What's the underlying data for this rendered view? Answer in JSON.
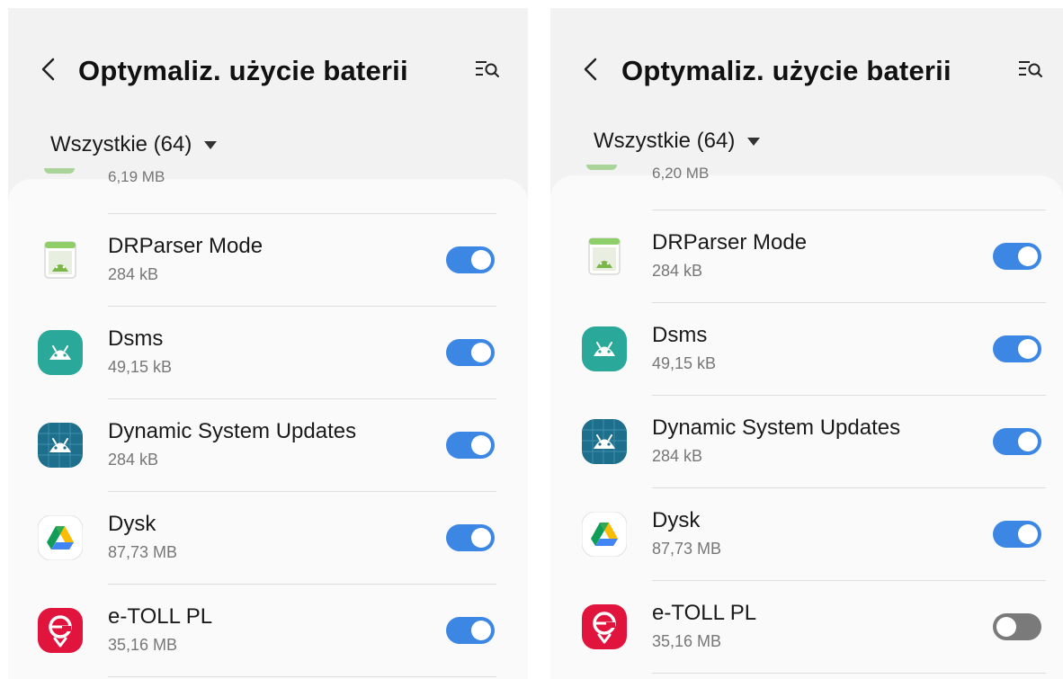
{
  "screens": [
    {
      "header": {
        "title": "Optymaliz. użycie baterii"
      },
      "filter": {
        "label": "Wszystkie (64)"
      },
      "partial_item": {
        "size": "6,19 MB"
      },
      "apps": [
        {
          "name": "DRParser Mode",
          "size": "284 kB",
          "enabled": true
        },
        {
          "name": "Dsms",
          "size": "49,15 kB",
          "enabled": true
        },
        {
          "name": "Dynamic System Updates",
          "size": "284 kB",
          "enabled": true
        },
        {
          "name": "Dysk",
          "size": "87,73 MB",
          "enabled": true
        },
        {
          "name": "e-TOLL PL",
          "size": "35,16 MB",
          "enabled": true
        }
      ]
    },
    {
      "header": {
        "title": "Optymaliz. użycie baterii"
      },
      "filter": {
        "label": "Wszystkie (64)"
      },
      "partial_item": {
        "size": "6,20 MB"
      },
      "apps": [
        {
          "name": "DRParser Mode",
          "size": "284 kB",
          "enabled": true
        },
        {
          "name": "Dsms",
          "size": "49,15 kB",
          "enabled": true
        },
        {
          "name": "Dynamic System Updates",
          "size": "284 kB",
          "enabled": true
        },
        {
          "name": "Dysk",
          "size": "87,73 MB",
          "enabled": true
        },
        {
          "name": "e-TOLL PL",
          "size": "35,16 MB",
          "enabled": false
        }
      ]
    }
  ],
  "colors": {
    "toggle_on": "#3c87e4",
    "toggle_off": "#7a7a7a",
    "dsms_icon": "#2aa89a",
    "dynamic_updates_icon": "#1e6f8c",
    "etoll_icon": "#e0143c"
  },
  "icons": [
    "back-arrow-icon",
    "search-list-icon",
    "dropdown-arrow-icon",
    "drparser-icon",
    "android-icon",
    "android-grid-icon",
    "google-drive-icon",
    "etoll-icon"
  ]
}
